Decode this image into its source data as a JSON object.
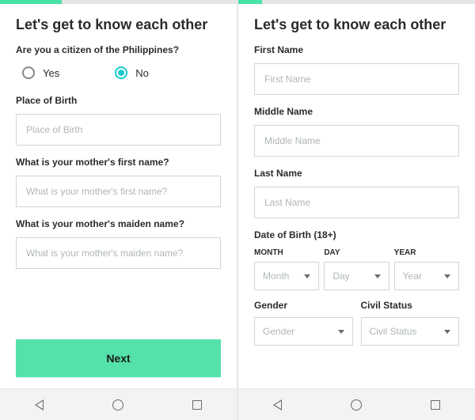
{
  "left": {
    "title": "Let's get to know each other",
    "q_citizen": "Are you a citizen of the Philippines?",
    "opt_yes": "Yes",
    "opt_no": "No",
    "selected": "No",
    "q_place": "Place of Birth",
    "ph_place": "Place of Birth",
    "q_mother_first": "What is your mother's first name?",
    "ph_mother_first": "What is your mother's first name?",
    "q_mother_maiden": "What is your mother's maiden name?",
    "ph_mother_maiden": "What is your mother's maiden name?",
    "next": "Next"
  },
  "right": {
    "title": "Let's get to know each other",
    "q_first": "First Name",
    "ph_first": "First Name",
    "q_middle": "Middle Name",
    "ph_middle": "Middle Name",
    "q_last": "Last Name",
    "ph_last": "Last Name",
    "q_dob": "Date of Birth (18+)",
    "lbl_month": "MONTH",
    "lbl_day": "DAY",
    "lbl_year": "YEAR",
    "sel_month": "Month",
    "sel_day": "Day",
    "sel_year": "Year",
    "q_gender": "Gender",
    "sel_gender": "Gender",
    "q_civil": "Civil Status",
    "sel_civil": "Civil Status"
  }
}
